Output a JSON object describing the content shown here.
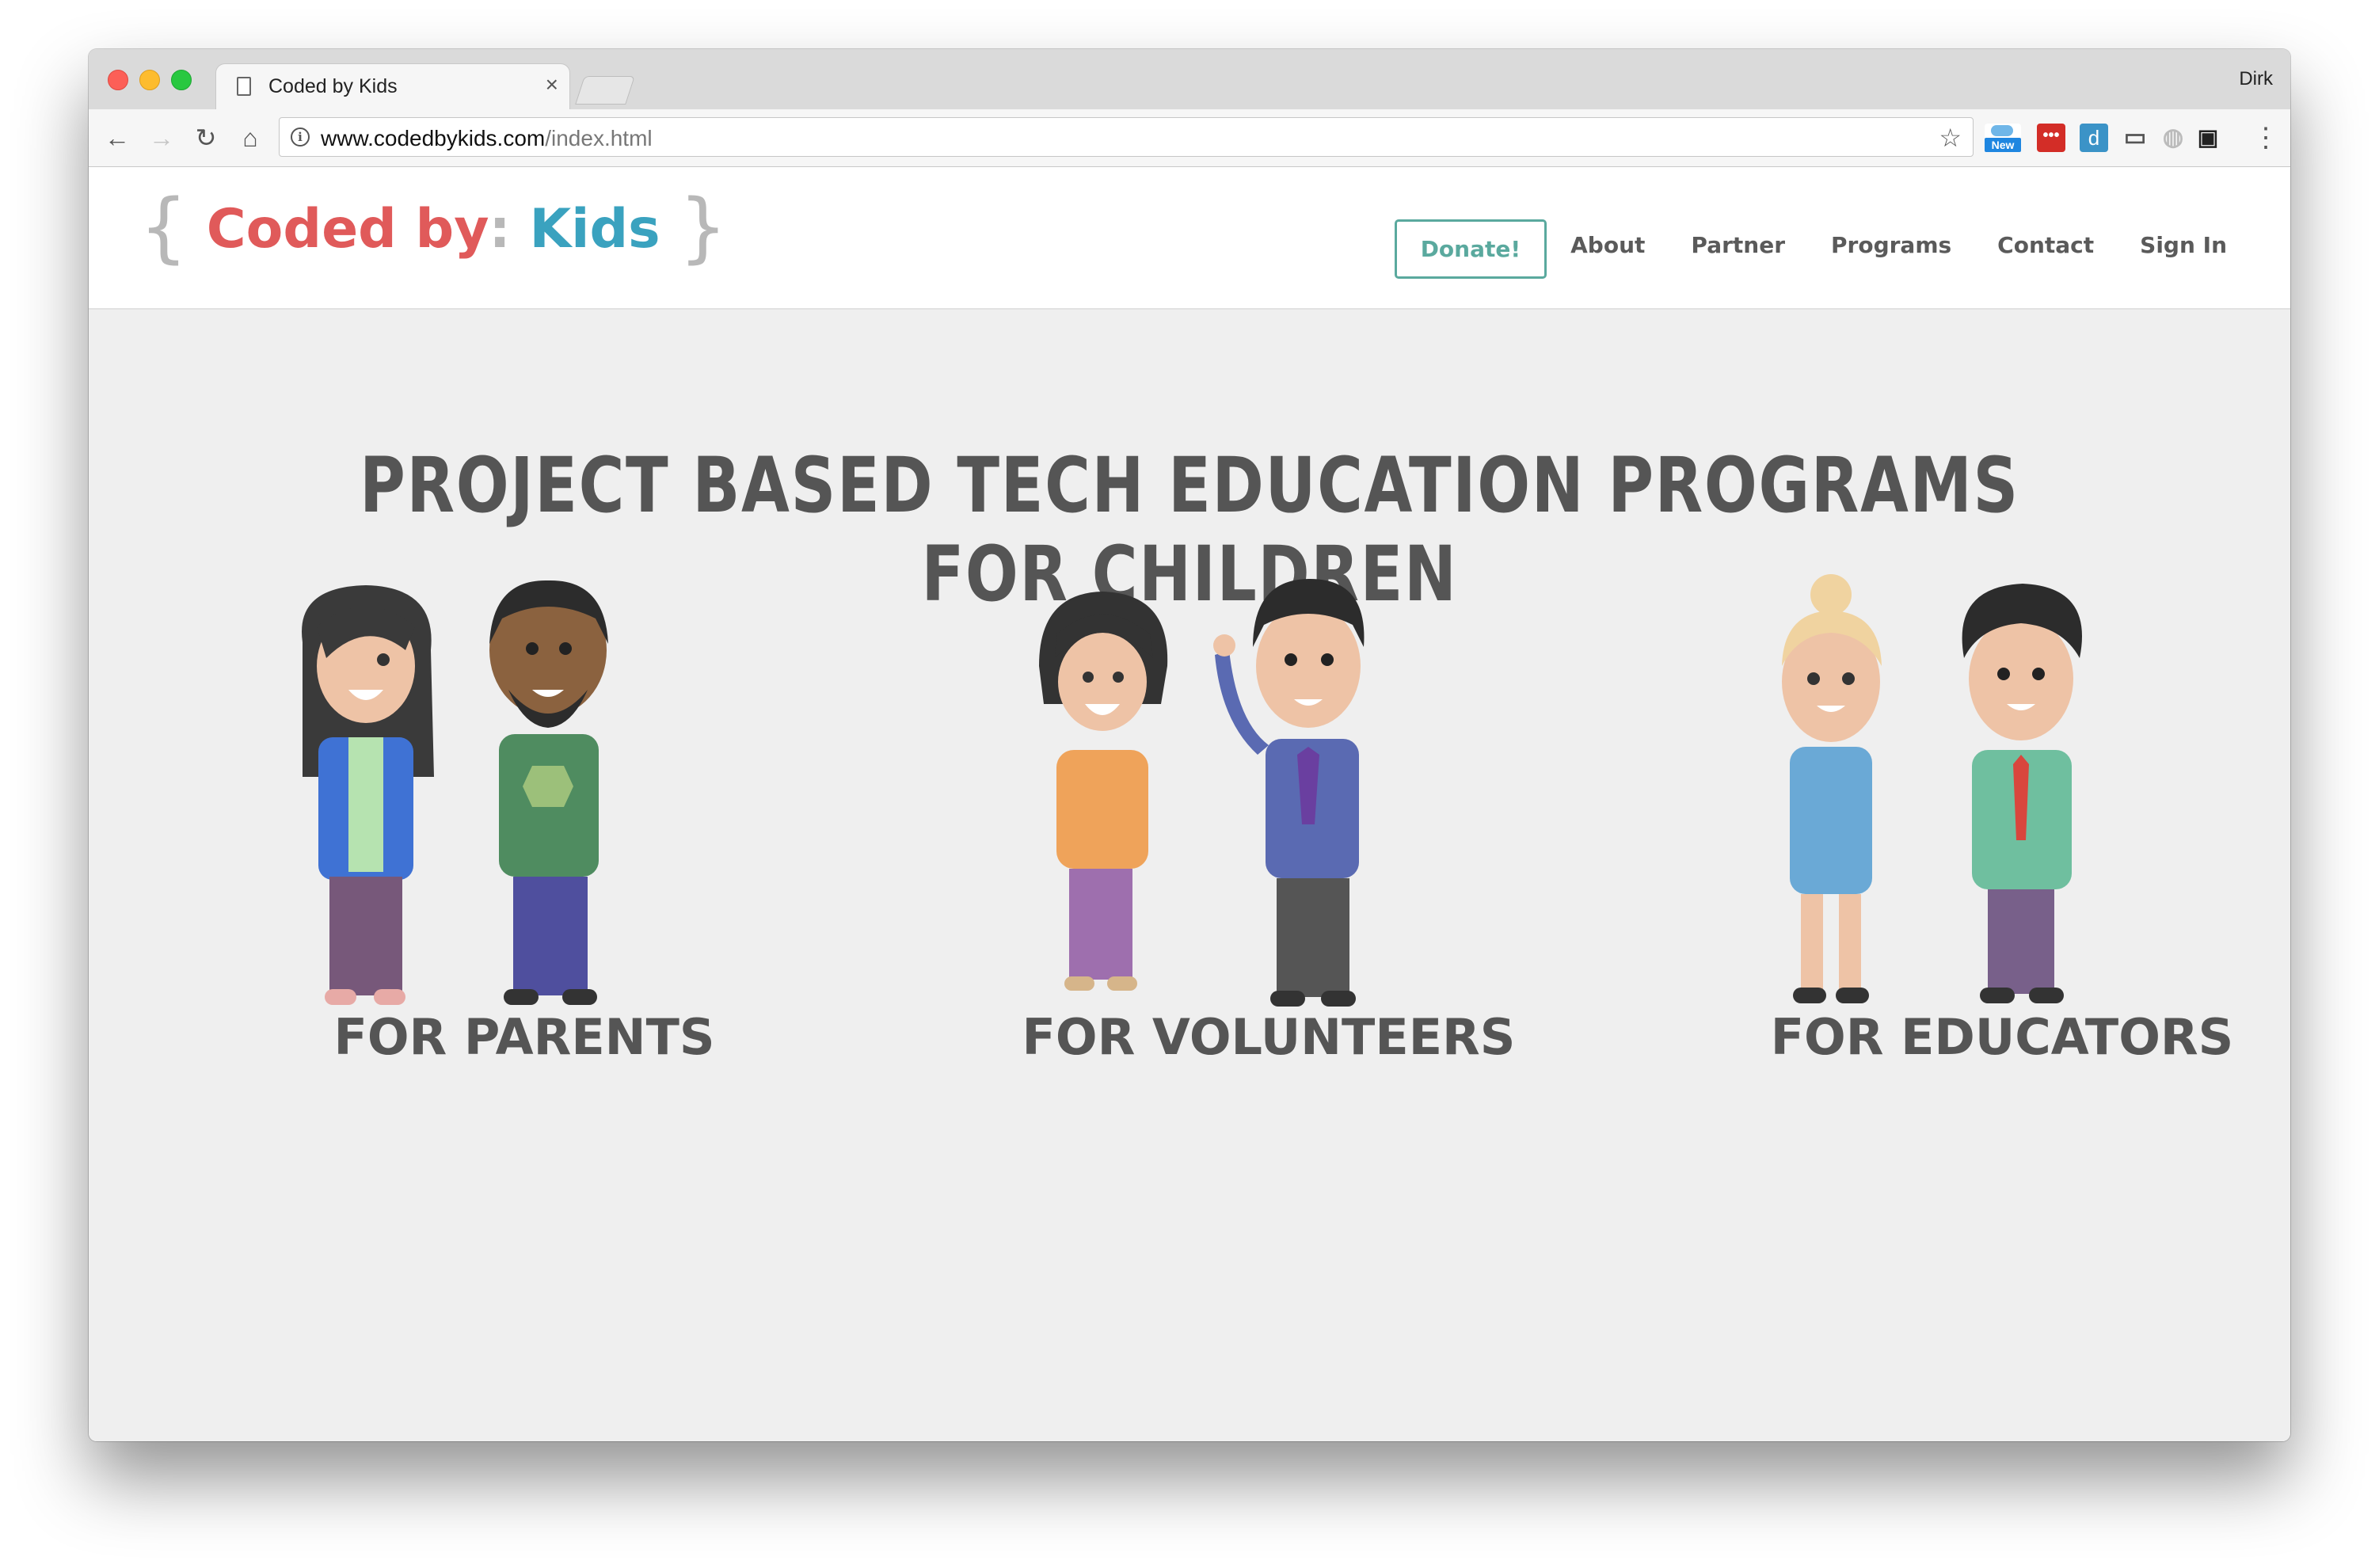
{
  "browser": {
    "tab_title": "Coded by Kids",
    "profile_name": "Dirk",
    "url_domain": "www.codedbykids.com",
    "url_path": "/index.html",
    "extension_weather_badge": "New",
    "extension_d_label": "d"
  },
  "site": {
    "logo": {
      "open_brace": "{",
      "coded_by": "Coded by",
      "colon": ":",
      "kids": "Kids",
      "close_brace": "}"
    },
    "nav": {
      "donate": "Donate!",
      "about": "About",
      "partner": "Partner",
      "programs": "Programs",
      "contact": "Contact",
      "sign_in": "Sign In"
    },
    "hero_title": "PROJECT BASED TECH EDUCATION PROGRAMS FOR CHILDREN",
    "audiences": [
      {
        "label": "FOR PARENTS"
      },
      {
        "label": "FOR VOLUNTEERS"
      },
      {
        "label": "FOR EDUCATORS"
      }
    ]
  },
  "colors": {
    "logo_coded": "#e05a5a",
    "logo_kids": "#3aa2bf",
    "donate_accent": "#5aa99e",
    "heading_gray": "#555555",
    "page_background": "#efefef"
  }
}
